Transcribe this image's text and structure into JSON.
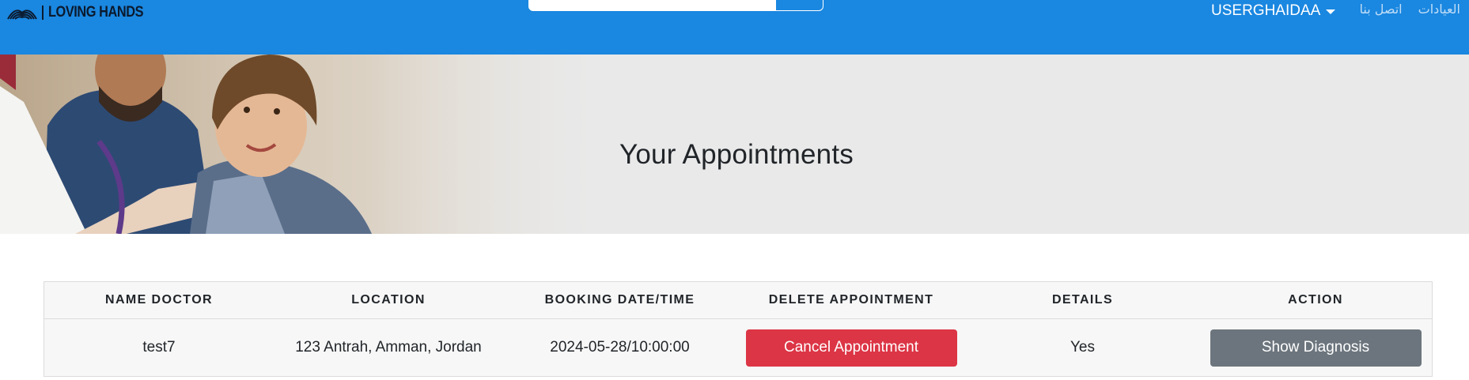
{
  "navbar": {
    "brand": "LOVING HANDS",
    "search": {
      "value": "",
      "placeholder": ""
    },
    "user": {
      "label": "USERGHAIDAA"
    },
    "links": [
      {
        "label": "العيادات"
      },
      {
        "label": "اتصل بنا"
      }
    ]
  },
  "hero": {
    "title": "Your Appointments"
  },
  "table": {
    "headers": [
      "NAME DOCTOR",
      "LOCATION",
      "BOOKING DATE/TIME",
      "DELETE APPOINTMENT",
      "DETAILS",
      "ACTION"
    ],
    "rows": [
      {
        "doctor": "test7",
        "location": "123 Antrah, Amman, Jordan",
        "datetime": "2024-05-28/10:00:00",
        "delete_label": "Cancel Appointment",
        "details": "Yes",
        "action_label": "Show Diagnosis"
      }
    ]
  },
  "colors": {
    "navbar": "#1a87e0",
    "hero_bg": "#e9e9e9",
    "danger": "#dc3545",
    "secondary": "#6c757d"
  }
}
